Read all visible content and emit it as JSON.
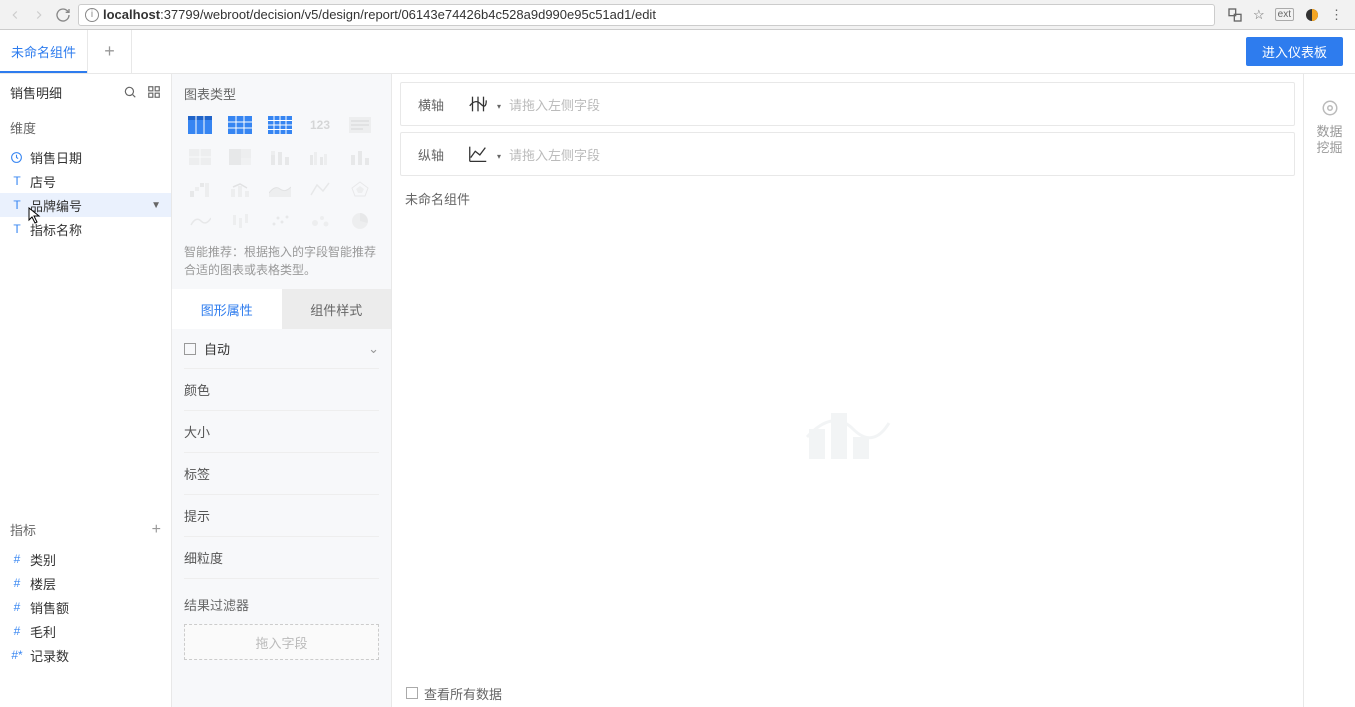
{
  "browser": {
    "url_host": "localhost",
    "url_rest": ":37799/webroot/decision/v5/design/report/06143e74426b4c528a9d990e95c51ad1/edit"
  },
  "tabs": {
    "current": "未命名组件",
    "enter_dashboard": "进入仪表板"
  },
  "fields": {
    "table_name": "销售明细",
    "dim_label": "维度",
    "dims": [
      {
        "icon": "clock",
        "label": "销售日期"
      },
      {
        "icon": "T",
        "label": "店号"
      },
      {
        "icon": "T",
        "label": "品牌编号",
        "hover": true,
        "caret": true
      },
      {
        "icon": "T",
        "label": "指标名称"
      }
    ],
    "metric_label": "指标",
    "metrics": [
      {
        "label": "类别"
      },
      {
        "label": "楼层"
      },
      {
        "label": "销售额"
      },
      {
        "label": "毛利"
      },
      {
        "label": "记录数",
        "star": true
      }
    ]
  },
  "chart_type": {
    "title": "图表类型",
    "hint": "智能推荐：根据拖入的字段智能推荐合适的图表或表格类型。",
    "prop_tabs": {
      "graphic": "图形属性",
      "style": "组件样式"
    },
    "auto": "自动",
    "items": {
      "color": "颜色",
      "size": "大小",
      "label": "标签",
      "tip": "提示",
      "granularity": "细粒度"
    },
    "filter_title": "结果过滤器",
    "filter_drop": "拖入字段"
  },
  "canvas": {
    "x_axis": "横轴",
    "y_axis": "纵轴",
    "drop_hint": "请拖入左侧字段",
    "title": "未命名组件",
    "footer_label": "查看所有数据"
  },
  "mining": {
    "label_line1": "数据",
    "label_line2": "挖掘"
  }
}
